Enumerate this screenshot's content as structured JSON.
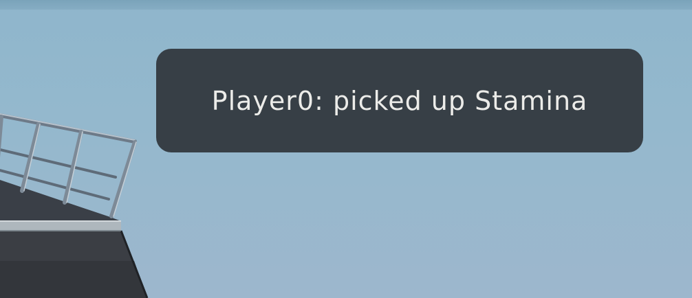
{
  "notification": {
    "message": "Player0: picked up Stamina"
  },
  "scene": {
    "sky_color": "#94b8cd",
    "notification_bg": "#373f46",
    "notification_text_color": "#ecece9",
    "objects": [
      "ship-deck",
      "deck-railing"
    ]
  }
}
